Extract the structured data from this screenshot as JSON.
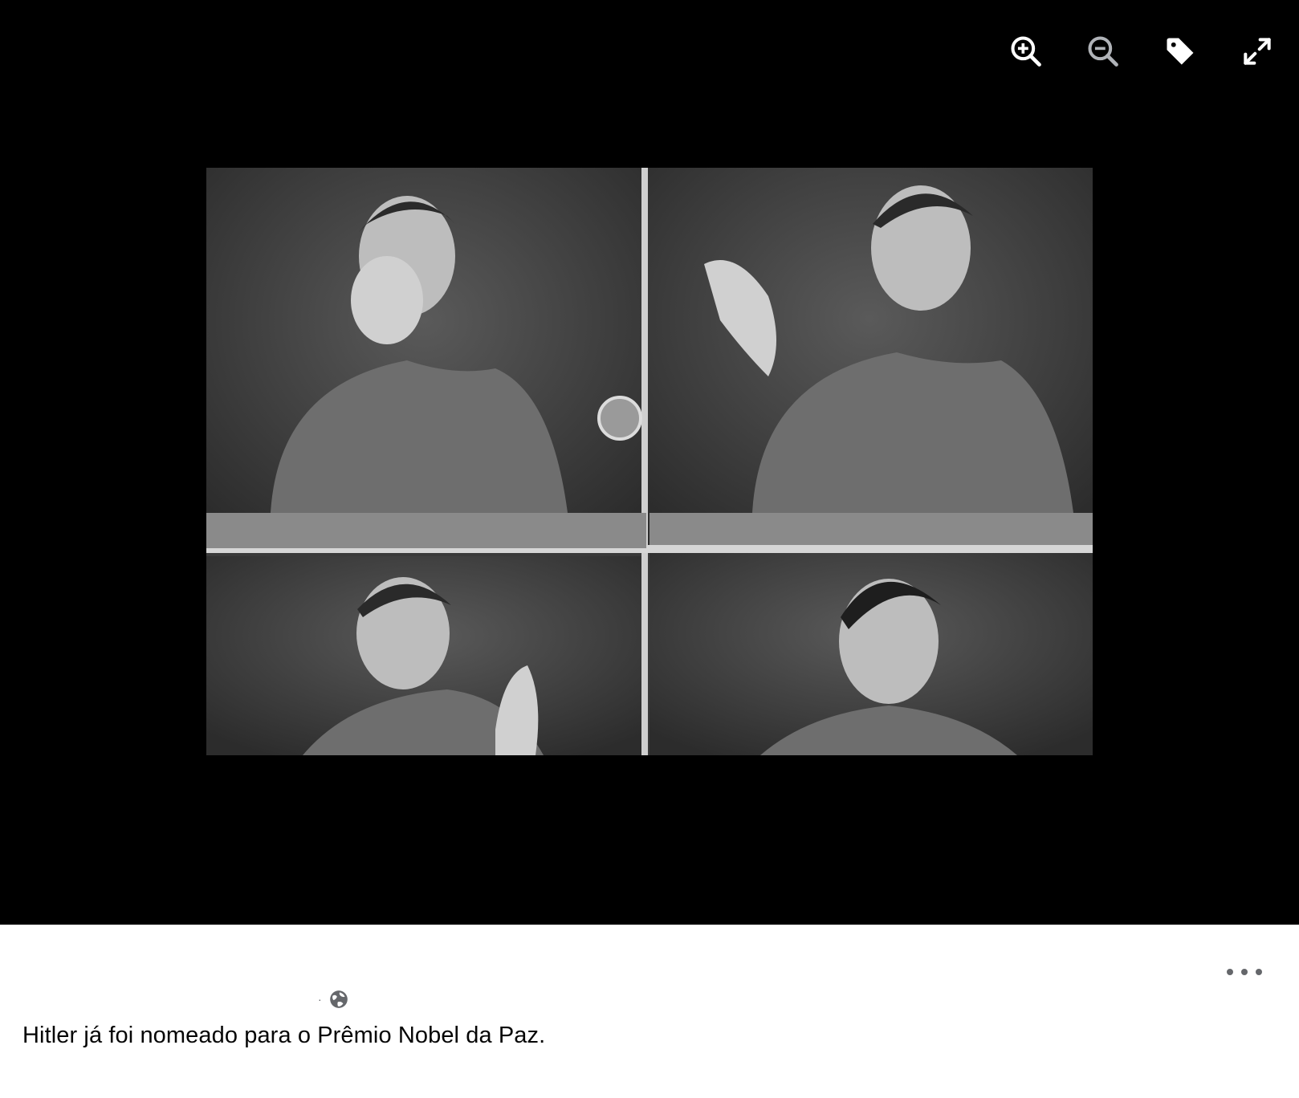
{
  "toolbar": {
    "zoom_in_icon": "zoom-in-icon",
    "zoom_out_icon": "zoom-out-icon",
    "tag_icon": "tag-icon",
    "fullscreen_icon": "expand-icon"
  },
  "photo": {
    "description_icon": "photo"
  },
  "post": {
    "separator": "·",
    "privacy_icon": "globe-icon",
    "caption": "Hitler já foi nomeado para o Prêmio Nobel da Paz.",
    "more_icon": "more-icon"
  },
  "colors": {
    "viewer_bg": "#000000",
    "post_bg": "#ffffff",
    "text": "#050505",
    "secondary_text": "#65676b"
  }
}
